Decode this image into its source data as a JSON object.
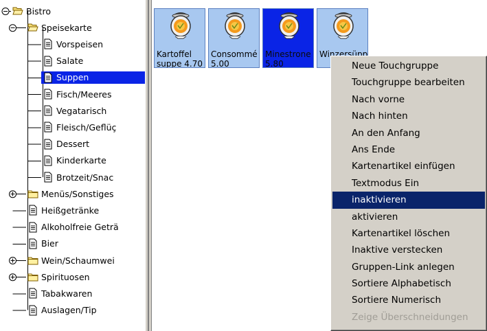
{
  "tree": {
    "items": [
      {
        "label": "Bistro",
        "icon": "folder-open-icon",
        "expander": "minus"
      },
      {
        "label": "Speisekarte",
        "icon": "folder-open-icon",
        "expander": "minus"
      },
      {
        "label": "Vorspeisen",
        "icon": "document-icon"
      },
      {
        "label": "Salate",
        "icon": "document-icon"
      },
      {
        "label": "Suppen",
        "icon": "document-icon",
        "selected": true
      },
      {
        "label": "Fisch/Meeres",
        "icon": "document-icon"
      },
      {
        "label": "Vegatarisch",
        "icon": "document-icon"
      },
      {
        "label": "Fleisch/Geflüç",
        "icon": "document-icon"
      },
      {
        "label": "Dessert",
        "icon": "document-icon"
      },
      {
        "label": "Kinderkarte",
        "icon": "document-icon"
      },
      {
        "label": "Brotzeit/Snac",
        "icon": "document-icon"
      },
      {
        "label": "Menüs/Sonstiges",
        "icon": "folder-closed-icon",
        "expander": "plus"
      },
      {
        "label": "Heißgetränke",
        "icon": "document-icon"
      },
      {
        "label": "Alkoholfreie Geträ",
        "icon": "document-icon"
      },
      {
        "label": "Bier",
        "icon": "document-icon"
      },
      {
        "label": "Wein/Schaumwei",
        "icon": "folder-closed-icon",
        "expander": "plus"
      },
      {
        "label": "Spirituosen",
        "icon": "folder-closed-icon",
        "expander": "plus"
      },
      {
        "label": "Tabakwaren",
        "icon": "document-icon"
      },
      {
        "label": "Auslagen/Tip",
        "icon": "document-icon"
      }
    ]
  },
  "tiles": [
    {
      "name": "Kartoffel",
      "price": "suppe  4.70",
      "icon": "soup-pot-icon"
    },
    {
      "name": "Consommé",
      "price": "5.00",
      "icon": "soup-pot-icon"
    },
    {
      "name": "Minestrone",
      "price": "5.80",
      "icon": "soup-pot-icon",
      "active": true
    },
    {
      "name": "Winzersüpp",
      "price": "",
      "icon": "soup-pot-icon"
    }
  ],
  "context_menu": {
    "items": [
      {
        "label": "Neue Touchgruppe"
      },
      {
        "label": "Touchgruppe bearbeiten"
      },
      {
        "label": "Nach vorne"
      },
      {
        "label": "Nach hinten"
      },
      {
        "label": "An den Anfang"
      },
      {
        "label": "Ans Ende"
      },
      {
        "label": "Kartenartikel einfügen"
      },
      {
        "label": "Textmodus Ein"
      },
      {
        "label": "inaktivieren",
        "highlighted": true
      },
      {
        "label": "aktivieren"
      },
      {
        "label": "Kartenartikel löschen"
      },
      {
        "label": "Inaktive verstecken"
      },
      {
        "label": "Gruppen-Link anlegen"
      },
      {
        "label": "Sortiere Alphabetisch"
      },
      {
        "label": "Sortiere Numerisch"
      },
      {
        "label": "Zeige Überschneidungen",
        "disabled": true
      }
    ]
  },
  "colors": {
    "selection": "#0a24e6",
    "menu_highlight": "#0a246a",
    "tile_bg": "#a8c8f0",
    "menu_bg": "#d4d0c8"
  }
}
